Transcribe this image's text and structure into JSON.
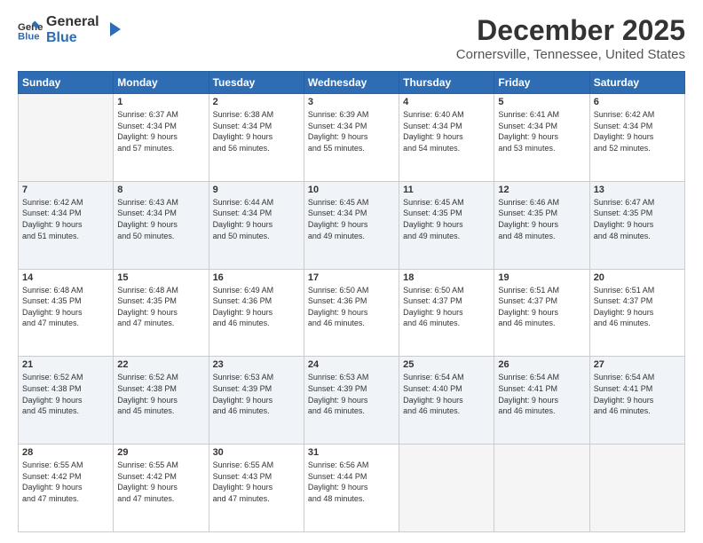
{
  "header": {
    "logo_general": "General",
    "logo_blue": "Blue",
    "title": "December 2025",
    "subtitle": "Cornersville, Tennessee, United States"
  },
  "calendar": {
    "days_of_week": [
      "Sunday",
      "Monday",
      "Tuesday",
      "Wednesday",
      "Thursday",
      "Friday",
      "Saturday"
    ],
    "weeks": [
      [
        {
          "day": "",
          "info": ""
        },
        {
          "day": "1",
          "info": "Sunrise: 6:37 AM\nSunset: 4:34 PM\nDaylight: 9 hours\nand 57 minutes."
        },
        {
          "day": "2",
          "info": "Sunrise: 6:38 AM\nSunset: 4:34 PM\nDaylight: 9 hours\nand 56 minutes."
        },
        {
          "day": "3",
          "info": "Sunrise: 6:39 AM\nSunset: 4:34 PM\nDaylight: 9 hours\nand 55 minutes."
        },
        {
          "day": "4",
          "info": "Sunrise: 6:40 AM\nSunset: 4:34 PM\nDaylight: 9 hours\nand 54 minutes."
        },
        {
          "day": "5",
          "info": "Sunrise: 6:41 AM\nSunset: 4:34 PM\nDaylight: 9 hours\nand 53 minutes."
        },
        {
          "day": "6",
          "info": "Sunrise: 6:42 AM\nSunset: 4:34 PM\nDaylight: 9 hours\nand 52 minutes."
        }
      ],
      [
        {
          "day": "7",
          "info": "Sunrise: 6:42 AM\nSunset: 4:34 PM\nDaylight: 9 hours\nand 51 minutes."
        },
        {
          "day": "8",
          "info": "Sunrise: 6:43 AM\nSunset: 4:34 PM\nDaylight: 9 hours\nand 50 minutes."
        },
        {
          "day": "9",
          "info": "Sunrise: 6:44 AM\nSunset: 4:34 PM\nDaylight: 9 hours\nand 50 minutes."
        },
        {
          "day": "10",
          "info": "Sunrise: 6:45 AM\nSunset: 4:34 PM\nDaylight: 9 hours\nand 49 minutes."
        },
        {
          "day": "11",
          "info": "Sunrise: 6:45 AM\nSunset: 4:35 PM\nDaylight: 9 hours\nand 49 minutes."
        },
        {
          "day": "12",
          "info": "Sunrise: 6:46 AM\nSunset: 4:35 PM\nDaylight: 9 hours\nand 48 minutes."
        },
        {
          "day": "13",
          "info": "Sunrise: 6:47 AM\nSunset: 4:35 PM\nDaylight: 9 hours\nand 48 minutes."
        }
      ],
      [
        {
          "day": "14",
          "info": "Sunrise: 6:48 AM\nSunset: 4:35 PM\nDaylight: 9 hours\nand 47 minutes."
        },
        {
          "day": "15",
          "info": "Sunrise: 6:48 AM\nSunset: 4:35 PM\nDaylight: 9 hours\nand 47 minutes."
        },
        {
          "day": "16",
          "info": "Sunrise: 6:49 AM\nSunset: 4:36 PM\nDaylight: 9 hours\nand 46 minutes."
        },
        {
          "day": "17",
          "info": "Sunrise: 6:50 AM\nSunset: 4:36 PM\nDaylight: 9 hours\nand 46 minutes."
        },
        {
          "day": "18",
          "info": "Sunrise: 6:50 AM\nSunset: 4:37 PM\nDaylight: 9 hours\nand 46 minutes."
        },
        {
          "day": "19",
          "info": "Sunrise: 6:51 AM\nSunset: 4:37 PM\nDaylight: 9 hours\nand 46 minutes."
        },
        {
          "day": "20",
          "info": "Sunrise: 6:51 AM\nSunset: 4:37 PM\nDaylight: 9 hours\nand 46 minutes."
        }
      ],
      [
        {
          "day": "21",
          "info": "Sunrise: 6:52 AM\nSunset: 4:38 PM\nDaylight: 9 hours\nand 45 minutes."
        },
        {
          "day": "22",
          "info": "Sunrise: 6:52 AM\nSunset: 4:38 PM\nDaylight: 9 hours\nand 45 minutes."
        },
        {
          "day": "23",
          "info": "Sunrise: 6:53 AM\nSunset: 4:39 PM\nDaylight: 9 hours\nand 46 minutes."
        },
        {
          "day": "24",
          "info": "Sunrise: 6:53 AM\nSunset: 4:39 PM\nDaylight: 9 hours\nand 46 minutes."
        },
        {
          "day": "25",
          "info": "Sunrise: 6:54 AM\nSunset: 4:40 PM\nDaylight: 9 hours\nand 46 minutes."
        },
        {
          "day": "26",
          "info": "Sunrise: 6:54 AM\nSunset: 4:41 PM\nDaylight: 9 hours\nand 46 minutes."
        },
        {
          "day": "27",
          "info": "Sunrise: 6:54 AM\nSunset: 4:41 PM\nDaylight: 9 hours\nand 46 minutes."
        }
      ],
      [
        {
          "day": "28",
          "info": "Sunrise: 6:55 AM\nSunset: 4:42 PM\nDaylight: 9 hours\nand 47 minutes."
        },
        {
          "day": "29",
          "info": "Sunrise: 6:55 AM\nSunset: 4:42 PM\nDaylight: 9 hours\nand 47 minutes."
        },
        {
          "day": "30",
          "info": "Sunrise: 6:55 AM\nSunset: 4:43 PM\nDaylight: 9 hours\nand 47 minutes."
        },
        {
          "day": "31",
          "info": "Sunrise: 6:56 AM\nSunset: 4:44 PM\nDaylight: 9 hours\nand 48 minutes."
        },
        {
          "day": "",
          "info": ""
        },
        {
          "day": "",
          "info": ""
        },
        {
          "day": "",
          "info": ""
        }
      ]
    ]
  }
}
